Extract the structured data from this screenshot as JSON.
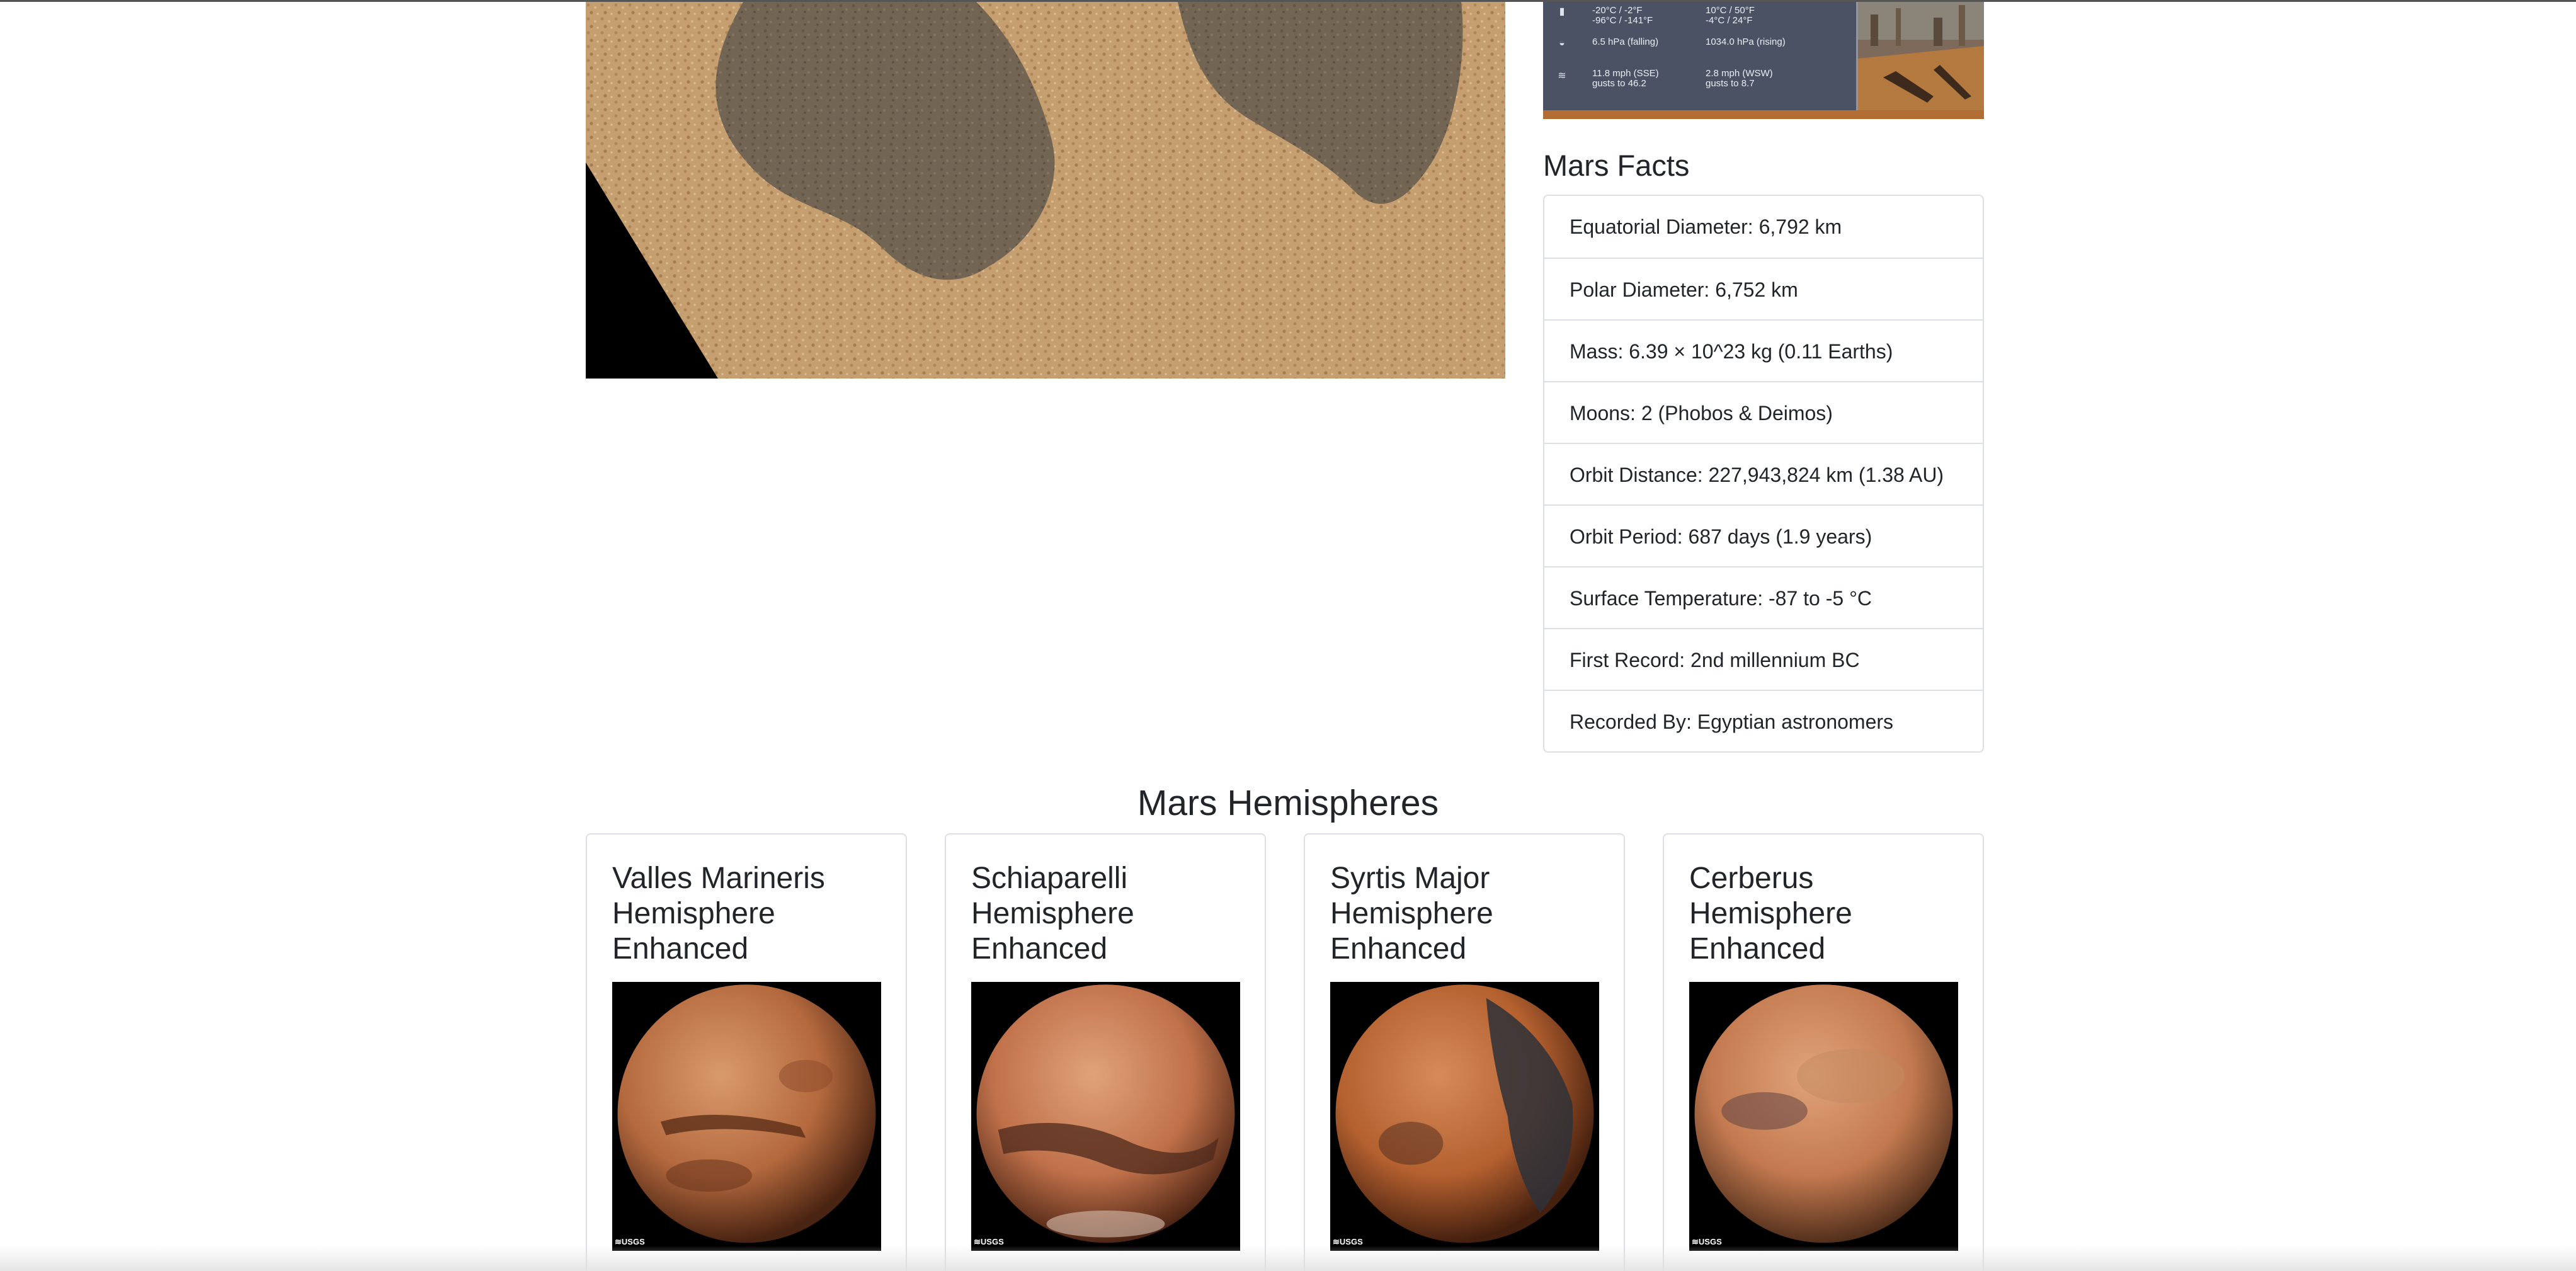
{
  "weather": {
    "rows": [
      {
        "icon": "thermometer-icon",
        "left": "-20°C / -2°F\n-96°C / -141°F",
        "right": "10°C / 50°F\n-4°C / 24°F"
      },
      {
        "icon": "pressure-gauge-icon",
        "left": "6.5 hPa (falling)",
        "right": "1034.0 hPa (rising)"
      },
      {
        "icon": "wind-icon",
        "left": "11.8 mph (SSE)\ngusts to 46.2",
        "right": "2.8 mph (WSW)\ngusts to 8.7"
      }
    ]
  },
  "facts": {
    "title": "Mars Facts",
    "items": [
      "Equatorial Diameter: 6,792 km",
      "Polar Diameter: 6,752 km",
      "Mass: 6.39 × 10^23 kg (0.11 Earths)",
      "Moons: 2 (Phobos & Deimos)",
      "Orbit Distance: 227,943,824 km (1.38 AU)",
      "Orbit Period: 687 days (1.9 years)",
      "Surface Temperature: -87 to -5 °C",
      "First Record: 2nd millennium BC",
      "Recorded By: Egyptian astronomers"
    ]
  },
  "hemispheres": {
    "title": "Mars Hemispheres",
    "cards": [
      {
        "title": "Valles Marineris Hemisphere Enhanced",
        "logo": "≋USGS"
      },
      {
        "title": "Schiaparelli Hemisphere Enhanced",
        "logo": "≋USGS"
      },
      {
        "title": "Syrtis Major Hemisphere Enhanced",
        "logo": "≋USGS"
      },
      {
        "title": "Cerberus Hemisphere Enhanced",
        "logo": "≋USGS"
      }
    ]
  },
  "colors": {
    "mars_surface": "#c29b6c",
    "border": "#dcdfe3",
    "text": "#212529"
  }
}
